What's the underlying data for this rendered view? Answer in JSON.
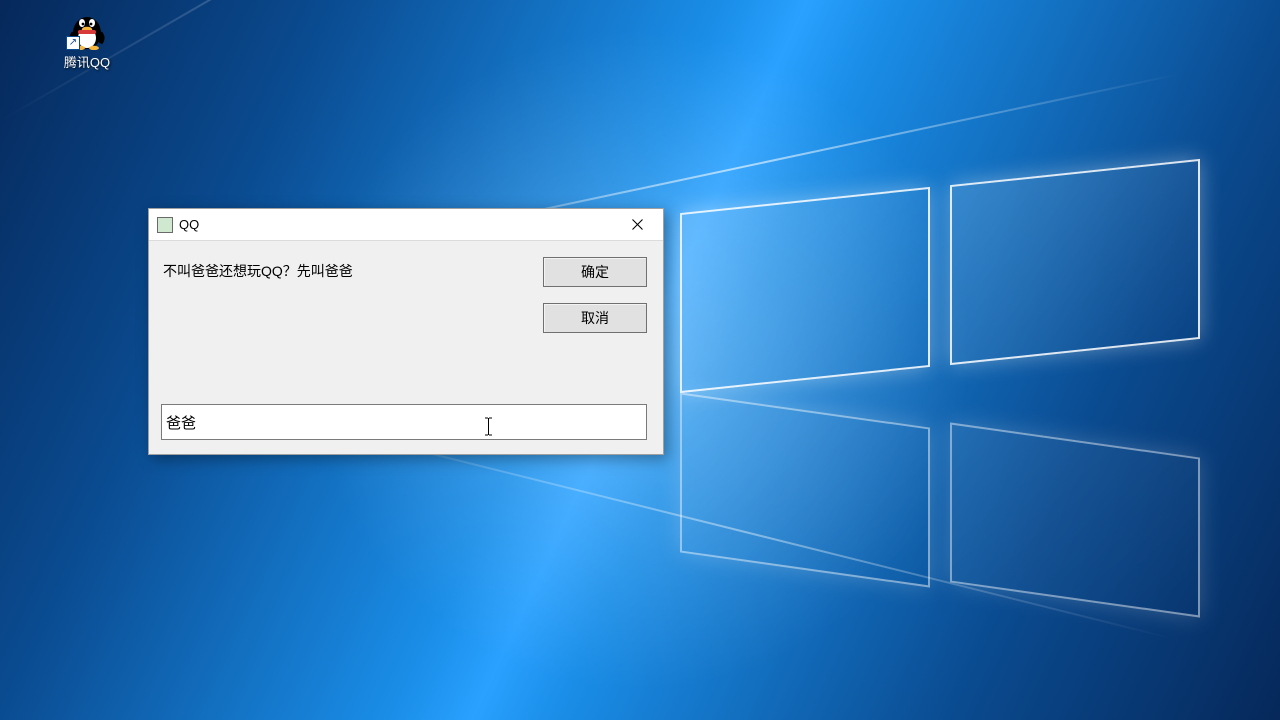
{
  "desktop": {
    "icon": {
      "name": "qq-penguin-icon",
      "label": "腾讯QQ"
    }
  },
  "dialog": {
    "title": "QQ",
    "prompt": "不叫爸爸还想玩QQ？先叫爸爸",
    "ok_label": "确定",
    "cancel_label": "取消",
    "input_value": "爸爸"
  }
}
